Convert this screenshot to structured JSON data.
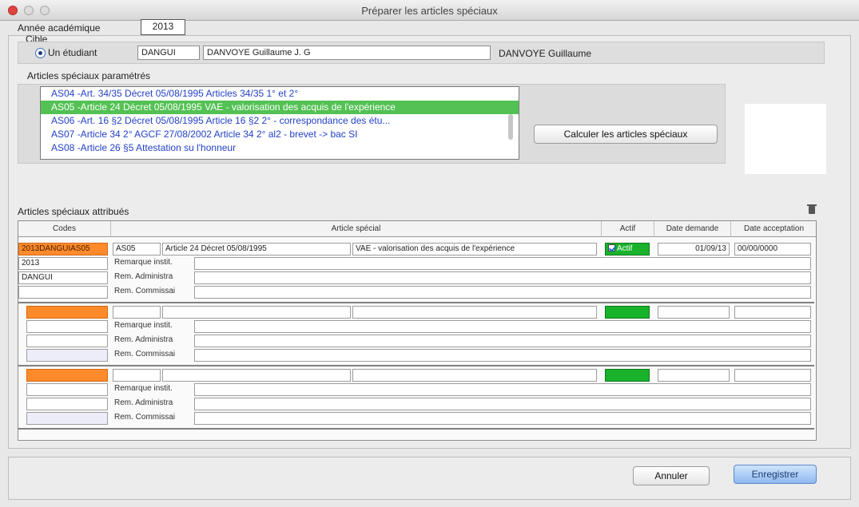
{
  "window": {
    "title": "Préparer les articles spéciaux"
  },
  "form": {
    "year_label": "Année académique",
    "year_value": "2013",
    "target_label": "Cible",
    "radio_label": "Un étudiant",
    "student_code": "DANGUI",
    "student_name": "DANVOYE Guillaume J. G",
    "student_display": "DANVOYE Guillaume"
  },
  "articles": {
    "section_label": "Articles spéciaux paramétrés",
    "items": [
      "AS04 -Art. 34/35 Décret 05/08/1995 Articles 34/35 1° et 2°",
      "AS05 -Article 24 Décret 05/08/1995 VAE - valorisation des acquis de l'expérience",
      "AS06 -Art. 16 §2 Décret 05/08/1995 Article 16 §2 2° - correspondance des étu...",
      "AS07 -Article 34 2° AGCF 27/08/2002 Article 34 2° al2 - brevet -> bac SI",
      "AS08 -Article 26 §5 Attestation su l'honneur"
    ],
    "selected_index": 1,
    "calc_button": "Calculer les articles spéciaux"
  },
  "attributed": {
    "section_label": "Articles spéciaux attribués",
    "columns": {
      "codes": "Codes",
      "article": "Article spécial",
      "actif": "Actif",
      "date_demande": "Date demande",
      "date_acceptation": "Date acceptation"
    },
    "row_labels": {
      "remarque": "Remarque instit.",
      "rem_admin": "Rem. Administra",
      "rem_comm": "Rem. Commissai"
    },
    "row1": {
      "code": "2013DANGUIAS05",
      "year": "2013",
      "student": "DANGUI",
      "article_code": "AS05",
      "article_decree": "Article 24 Décret 05/08/1995",
      "article_desc": "VAE - valorisation des acquis de l'expérience",
      "actif": "Actif",
      "date_demande": "01/09/13",
      "date_acceptation": "00/00/0000"
    }
  },
  "footer": {
    "cancel": "Annuler",
    "save": "Enregistrer"
  },
  "colors": {
    "selected_green": "#53c153",
    "actif_green": "#18b22b",
    "code_orange": "#ff8a2b",
    "list_blue": "#2341c8"
  }
}
